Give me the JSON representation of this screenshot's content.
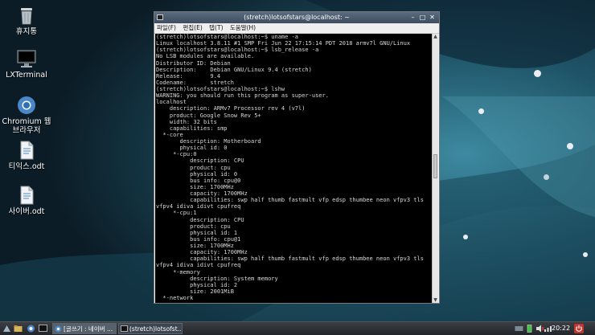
{
  "desktop": {
    "icons": [
      {
        "label": "휴지통",
        "icon": "trash-icon"
      },
      {
        "label": "LXTerminal",
        "icon": "monitor-icon"
      },
      {
        "label": "Chromium 웹 브라우저",
        "icon": "chromium-icon"
      },
      {
        "label": "티익스.odt",
        "icon": "document-icon"
      },
      {
        "label": "사이버.odt",
        "icon": "document-icon"
      }
    ]
  },
  "window": {
    "title": "(stretch)lotsofstars@localhost: ~",
    "menu": [
      "파일(F)",
      "편집(E)",
      "탭(T)",
      "도움말(H)"
    ],
    "terminal_text": "(stretch)lotsofstars@localhost:~$ uname -a\nLinux localhost 3.8.11 #1 SMP Fri Jun 22 17:15:14 PDT 2018 armv7l GNU/Linux\n(stretch)lotsofstars@localhost:~$ lsb_release -a\nNo LSB modules are available.\nDistributor ID: Debian\nDescription:    Debian GNU/Linux 9.4 (stretch)\nRelease:        9.4\nCodename:       stretch\n(stretch)lotsofstars@localhost:~$ lshw\nWARNING: you should run this program as super-user.\nlocalhost\n    description: ARMv7 Processor rev 4 (v7l)\n    product: Google Snow Rev 5+\n    width: 32 bits\n    capabilities: smp\n  *-core\n       description: Motherboard\n       physical id: 0\n     *-cpu:0\n          description: CPU\n          product: cpu\n          physical id: 0\n          bus info: cpu@0\n          size: 1700MHz\n          capacity: 1700MHz\n          capabilities: swp half thumb fastmult vfp edsp thumbee neon vfpv3 tls\nvfpv4 idiva idivt cpufreq\n     *-cpu:1\n          description: CPU\n          product: cpu\n          physical id: 1\n          bus info: cpu@1\n          size: 1700MHz\n          capacity: 1700MHz\n          capabilities: swp half thumb fastmult vfp edsp thumbee neon vfpv3 tls\nvfpv4 idiva idivt cpufreq\n     *-memory\n          description: System memory\n          physical id: 2\n          size: 2001MiB\n  *-network"
  },
  "taskbar": {
    "tasks": [
      {
        "label": "[글쓰기 : 네이버 ...",
        "icon": "chromium-icon"
      },
      {
        "label": "(stretch)lotsofst...",
        "icon": "terminal-icon"
      }
    ],
    "clock": "20:22"
  },
  "colors": {
    "wallpaper_dark": "#0f2a38",
    "wallpaper_mid": "#2f6f86",
    "terminal_bg": "#000000",
    "terminal_fg": "#d8d8d8"
  }
}
